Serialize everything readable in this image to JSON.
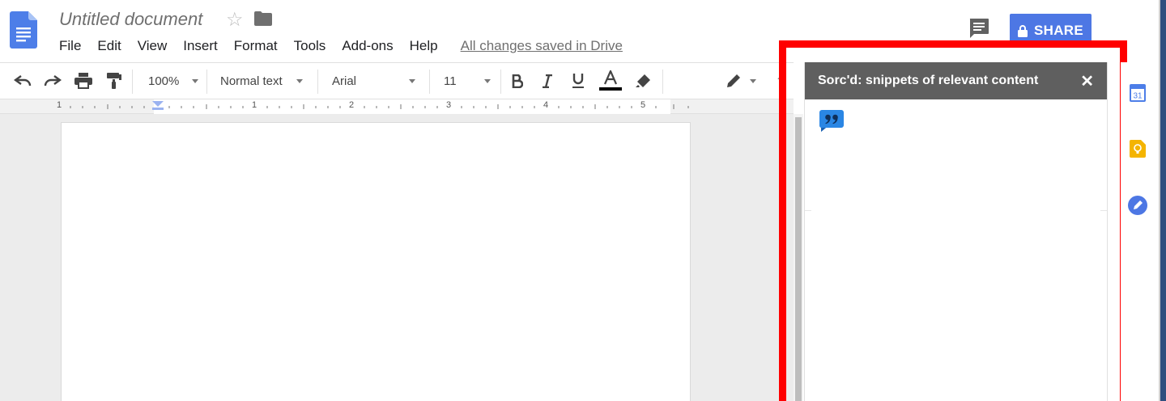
{
  "document": {
    "title": "Untitled document",
    "star_icon": "star-icon",
    "folder_icon": "folder-icon",
    "saved_status": "All changes saved in Drive"
  },
  "menu": {
    "items": [
      "File",
      "Edit",
      "View",
      "Insert",
      "Format",
      "Tools",
      "Add-ons",
      "Help"
    ]
  },
  "header": {
    "comments_icon": "comments-icon",
    "share_label": "SHARE",
    "share_color": "#4d77e4"
  },
  "toolbar": {
    "zoom": "100%",
    "style": "Normal text",
    "font": "Arial",
    "font_size": "11",
    "icons": [
      "undo-icon",
      "redo-icon",
      "print-icon",
      "paint-format-icon",
      "bold-icon",
      "italic-icon",
      "underline-icon",
      "text-color-icon",
      "highlight-icon",
      "editing-mode-icon"
    ]
  },
  "ruler": {
    "labels": [
      "1",
      "1",
      "2",
      "3",
      "4",
      "5"
    ]
  },
  "sidebar": {
    "title": "Sorc'd: snippets of relevant content",
    "close_symbol": "✕",
    "header_color": "#5f5f5f",
    "badge_icon": "quote-icon"
  },
  "rail": {
    "icons": [
      "calendar-icon",
      "keep-icon",
      "tasks-icon"
    ],
    "calendar_label": "31"
  },
  "highlight_color": "#ff0000"
}
